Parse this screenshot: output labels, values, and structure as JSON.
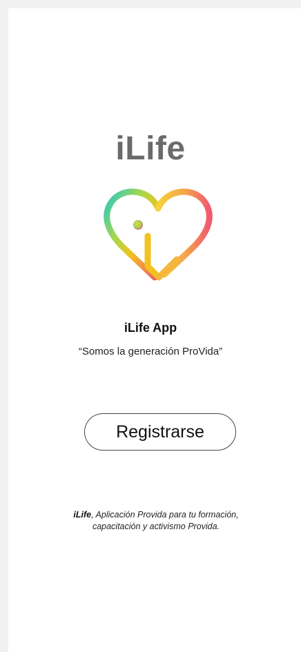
{
  "brand": {
    "title": "iLife",
    "logo_icon": "heart-i-logo-icon",
    "gradient_colors": [
      "#27c7c4",
      "#a8d84a",
      "#f2c21f",
      "#f07a6a",
      "#f05a6f"
    ]
  },
  "intro": {
    "app_name": "iLife App",
    "tagline": "“Somos la generación ProVida”"
  },
  "actions": {
    "register_label": "Registrarse"
  },
  "footer": {
    "brand": "iLife",
    "text": ", Aplicación Provida para tu formación, capacitación y activismo Provida."
  }
}
